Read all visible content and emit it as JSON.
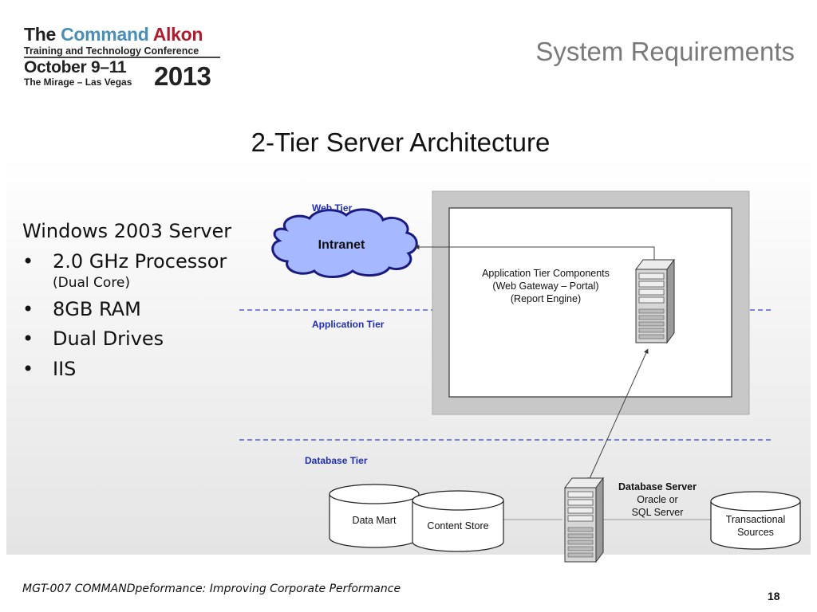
{
  "logo": {
    "brand_the": "The",
    "brand_command": "Command",
    "brand_alkon": "Alkon",
    "conference": "Training and Technology Conference",
    "dates": "October 9–11",
    "venue": "The Mirage – Las Vegas",
    "year": "2013"
  },
  "header": {
    "title": "System Requirements",
    "subtitle": "2-Tier Server Architecture"
  },
  "requirements": {
    "title": "Windows 2003 Server",
    "bullet_char": "•",
    "items": [
      "2.0 GHz Processor",
      "8GB RAM",
      "Dual Drives",
      "IIS"
    ],
    "processor_note": "(Dual Core)"
  },
  "diagram": {
    "tiers": {
      "web": "Web Tier",
      "application": "Application Tier",
      "database": "Database Tier"
    },
    "intranet": "Intranet",
    "app_components": [
      "Application Tier Components",
      "(Web Gateway – Portal)",
      "(Report Engine)"
    ],
    "db_server": {
      "title": "Database Server",
      "line1": "Oracle or",
      "line2": "SQL Server"
    },
    "data_mart": "Data Mart",
    "content_store": "Content Store",
    "transactional": [
      "Transactional",
      "Sources"
    ],
    "colors": {
      "tier_label": "#1f2eb3",
      "divider": "#3344cc",
      "cloud_fill": "#a6b8ff",
      "gray_frame": "#c8c8c8"
    }
  },
  "footer": {
    "text": "MGT-007 COMMANDpeformance: Improving Corporate Performance",
    "page": "18"
  }
}
